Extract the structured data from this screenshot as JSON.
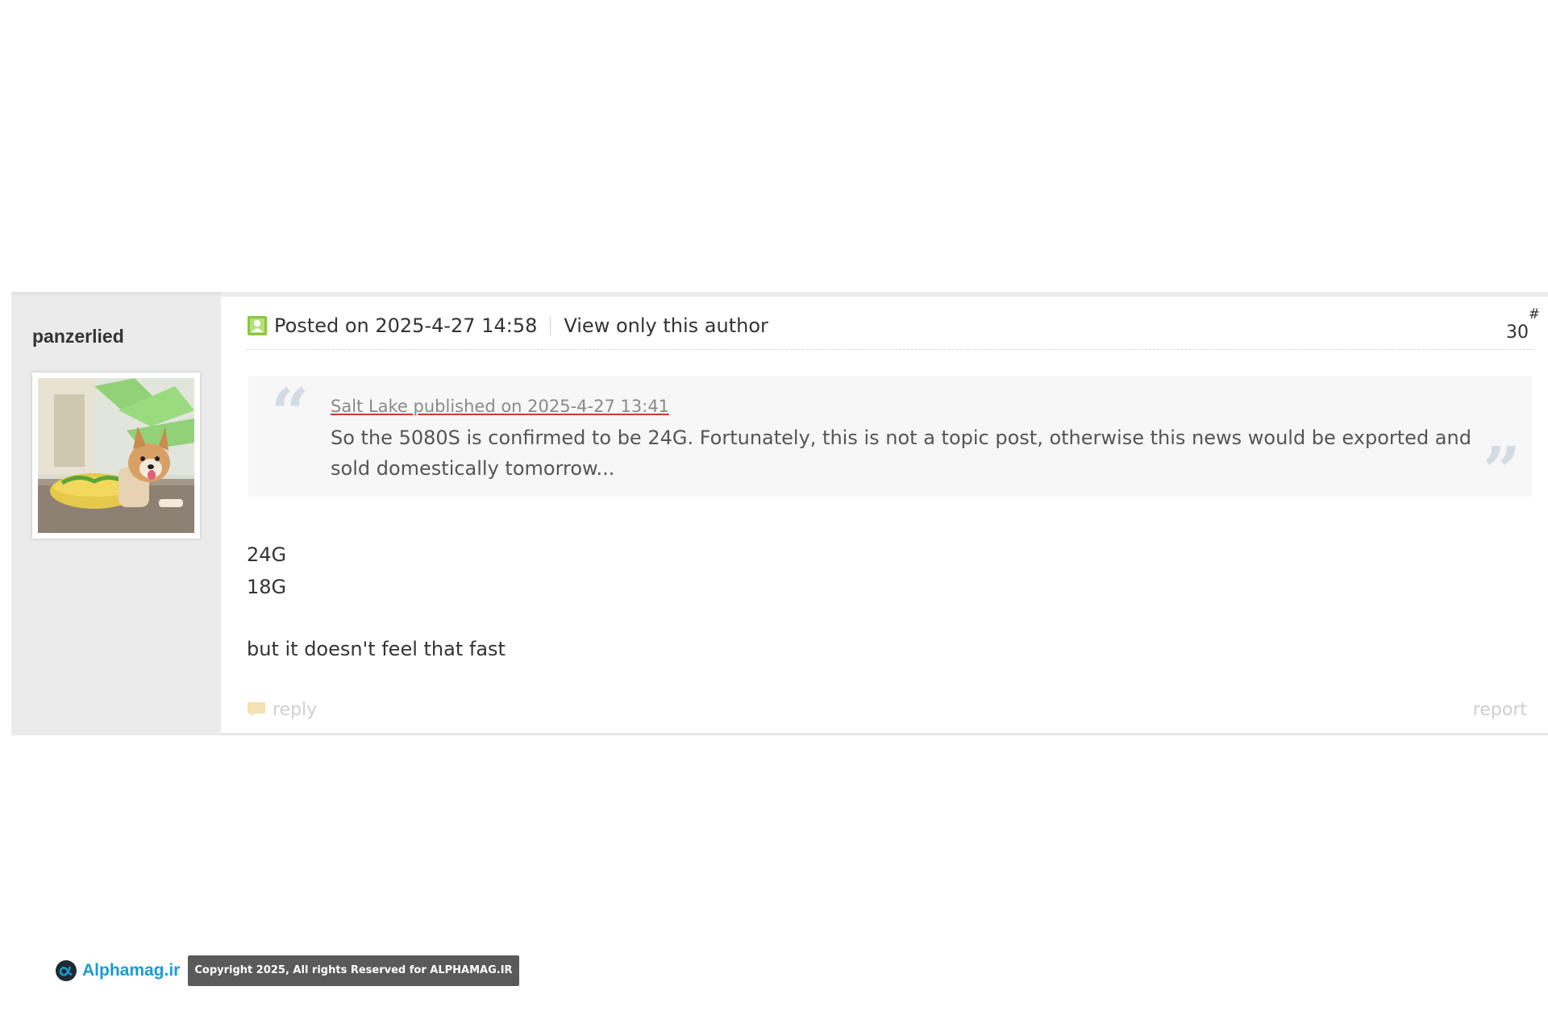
{
  "post": {
    "author": "panzerlied",
    "posted_on": "Posted on 2025-4-27 14:58",
    "view_only_author": "View only this author",
    "floor_hash": "#",
    "floor_number": "30",
    "quote": {
      "source": "Salt Lake published on 2025-4-27 13:41",
      "text": "So the 5080S is confirmed to be 24G. Fortunately, this is not a topic post, otherwise this news would be exported and sold domestically tomorrow..."
    },
    "body": {
      "line1": "24G",
      "line2": "18G",
      "line3": "but it doesn't feel that fast"
    },
    "footer": {
      "reply_label": "reply",
      "report_label": "report"
    }
  },
  "watermark": {
    "site": "Alphamag.ir",
    "copyright": "Copyright 2025, All rights Reserved for ALPHAMAG.IR"
  },
  "colors": {
    "sidebar_bg": "#ebebeb",
    "quote_bg": "#f7f7f7",
    "quote_mark": "#d3dbe4",
    "link_underline": "#c9383a",
    "brand_blue": "#1c9bd1"
  },
  "icons": {
    "author": "user-card-icon",
    "reply": "speech-bubble-icon",
    "brand": "alpha-logo-icon"
  }
}
